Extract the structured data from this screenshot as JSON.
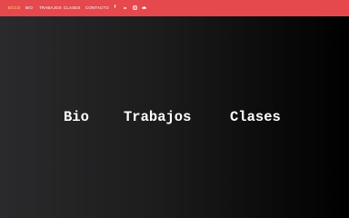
{
  "nav": {
    "items": [
      {
        "label": "ECCO",
        "active": true
      },
      {
        "label": "BIO"
      },
      {
        "label": "TRABAJOS"
      },
      {
        "label": "CLASES"
      },
      {
        "label": "CONTACTO"
      }
    ],
    "social": [
      "facebook-icon",
      "linkedin-icon",
      "instagram-icon",
      "soundcloud-icon"
    ],
    "social_glyphs": {
      "facebook": "f",
      "linkedin": "in"
    }
  },
  "hero": {
    "links": [
      "Bio",
      "Trabajos",
      "Clases"
    ]
  },
  "colors": {
    "navbar": "#e5484d",
    "active_nav": "#ffe06a",
    "text": "#ffffff"
  }
}
